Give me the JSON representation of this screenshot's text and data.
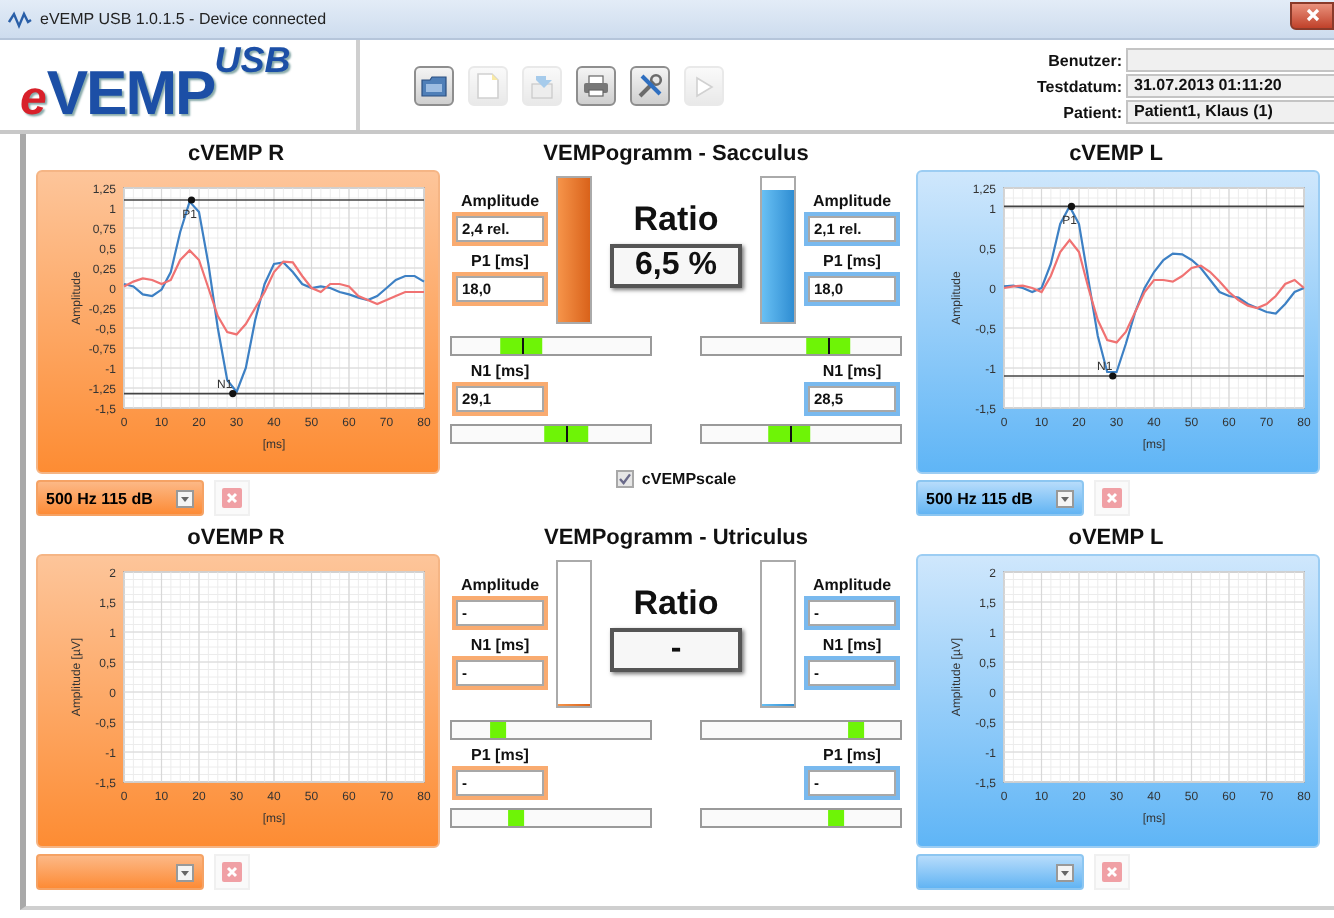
{
  "window": {
    "title": "eVEMP USB 1.0.1.5 - Device connected"
  },
  "logo": {
    "prefix": "e",
    "text": "VEMP",
    "superscript": "USB"
  },
  "toolbar": [
    {
      "kind": "folder",
      "disabled": false
    },
    {
      "kind": "new",
      "disabled": true
    },
    {
      "kind": "export",
      "disabled": true
    },
    {
      "kind": "print",
      "disabled": false
    },
    {
      "kind": "tools",
      "disabled": false
    },
    {
      "kind": "play",
      "disabled": true
    }
  ],
  "patient_info": [
    {
      "label": "Benutzer:"
    },
    {
      "label": "Testdatum:",
      "value": "31.07.2013 01:11:20"
    },
    {
      "label": "Patient:",
      "value": "Patient1, Klaus (1)"
    }
  ],
  "cvemp_r": {
    "title": "cVEMP R",
    "dropdown": {
      "value": "500 Hz 115 dB"
    },
    "delete_button": {
      "disabled": true
    },
    "chart_data": {
      "type": "line",
      "xlabel": "[ms]",
      "ylabel": "Amplitude",
      "xlim": [
        0,
        80
      ],
      "ylim": [
        -1.5,
        1.25
      ],
      "x": [
        0,
        2.5,
        5,
        7.5,
        10,
        12.5,
        15,
        17.5,
        20,
        22.5,
        25,
        27.5,
        30,
        32.5,
        35,
        37.5,
        40,
        42.5,
        45,
        47.5,
        50,
        52.5,
        55,
        57.5,
        60,
        62.5,
        65,
        67.5,
        70,
        72.5,
        75,
        77.5,
        80
      ],
      "xticks": [
        0,
        10,
        20,
        30,
        40,
        50,
        60,
        70,
        80
      ],
      "yticks": [
        {
          "value": 1.25,
          "label": "1,25"
        },
        {
          "value": 1,
          "label": "1"
        },
        {
          "value": 0.75,
          "label": "0,75"
        },
        {
          "value": 0.5,
          "label": "0,5"
        },
        {
          "value": 0.25,
          "label": "0,25"
        },
        {
          "value": 0,
          "label": "0"
        },
        {
          "value": -0.25,
          "label": "-0,25"
        },
        {
          "value": -0.5,
          "label": "-0,5"
        },
        {
          "value": -0.75,
          "label": "-0,75"
        },
        {
          "value": -1,
          "label": "-1"
        },
        {
          "value": -1.25,
          "label": "-1,25"
        },
        {
          "value": -1.5,
          "label": "-1,5"
        }
      ],
      "series": [
        {
          "color": "#3d80c4",
          "values": [
            0.05,
            0.02,
            -0.08,
            -0.1,
            -0.02,
            0.2,
            0.7,
            1.08,
            0.95,
            0.3,
            -0.5,
            -1.15,
            -1.3,
            -1.0,
            -0.4,
            0.05,
            0.3,
            0.32,
            0.2,
            0.05,
            0.0,
            0.02,
            0.0,
            -0.05,
            -0.08,
            -0.12,
            -0.15,
            -0.1,
            0.0,
            0.1,
            0.15,
            0.15,
            0.08
          ]
        },
        {
          "color": "#f07272",
          "values": [
            0.02,
            0.08,
            0.12,
            0.1,
            0.05,
            0.1,
            0.35,
            0.47,
            0.35,
            0.0,
            -0.35,
            -0.55,
            -0.58,
            -0.45,
            -0.25,
            -0.05,
            0.2,
            0.33,
            0.32,
            0.15,
            0.0,
            -0.05,
            0.05,
            0.05,
            0.02,
            -0.1,
            -0.15,
            -0.2,
            -0.15,
            -0.1,
            -0.05,
            -0.05,
            -0.05
          ]
        }
      ],
      "grid": true,
      "ref_lines": [
        {
          "axis": "y",
          "value": 1.1
        },
        {
          "axis": "y",
          "value": -1.32
        }
      ],
      "annotations": [
        {
          "text": "P1",
          "x": 18,
          "y": 1.1
        },
        {
          "text": "N1",
          "x": 29,
          "y": -1.32
        }
      ]
    }
  },
  "sacculus": {
    "title": "VEMPogramm - Sacculus",
    "ratio_label": "Ratio",
    "ratio": "6,5 %",
    "left_fields": [
      {
        "label": "Amplitude",
        "value": "2,4 rel."
      },
      {
        "label": "P1 [ms]",
        "value": "18,0"
      }
    ],
    "left_bar": {
      "level": 1.0
    },
    "right_bar": {
      "level": 0.92
    },
    "right_fields": [
      {
        "label": "Amplitude",
        "value": "2,1 rel."
      },
      {
        "label": "P1 [ms]",
        "value": "18,0"
      }
    ],
    "range_bars": [
      {
        "level": 0.35,
        "marker": true
      },
      {
        "level": 0.64,
        "marker": true
      }
    ],
    "lower_fields": [
      {
        "label": "N1 [ms]",
        "value": "29,1"
      },
      {
        "label": "N1 [ms]",
        "value": "28,5"
      }
    ],
    "lower_range_bars": [
      {
        "level": 0.58,
        "marker": true
      },
      {
        "level": 0.44,
        "marker": true
      }
    ]
  },
  "scale_checkbox": {
    "label": "cVEMPscale",
    "checked": true
  },
  "cvemp_l": {
    "title": "cVEMP L",
    "dropdown": {
      "value": "500 Hz 115 dB"
    },
    "delete_button": {
      "disabled": true
    },
    "chart_data": {
      "type": "line",
      "xlabel": "[ms]",
      "ylabel": "Amplitude",
      "xlim": [
        0,
        80
      ],
      "ylim": [
        -1.5,
        1.25
      ],
      "x": [
        0,
        2.5,
        5,
        7.5,
        10,
        12.5,
        15,
        17.5,
        20,
        22.5,
        25,
        27.5,
        30,
        32.5,
        35,
        37.5,
        40,
        42.5,
        45,
        47.5,
        50,
        52.5,
        55,
        57.5,
        60,
        62.5,
        65,
        67.5,
        70,
        72.5,
        75,
        77.5,
        80
      ],
      "xticks": [
        0,
        10,
        20,
        30,
        40,
        50,
        60,
        70,
        80
      ],
      "yticks": [
        {
          "value": 1.25,
          "label": "1,25"
        },
        {
          "value": 1,
          "label": "1"
        },
        {
          "value": 0.5,
          "label": "0,5"
        },
        {
          "value": 0,
          "label": "0"
        },
        {
          "value": -0.5,
          "label": "-0,5"
        },
        {
          "value": -1,
          "label": "-1"
        },
        {
          "value": -1.5,
          "label": "-1,5"
        }
      ],
      "series": [
        {
          "color": "#3d80c4",
          "values": [
            0.02,
            0.03,
            0.0,
            -0.05,
            0.0,
            0.3,
            0.8,
            1.02,
            0.8,
            0.1,
            -0.6,
            -1.05,
            -1.05,
            -0.7,
            -0.3,
            0.0,
            0.2,
            0.35,
            0.43,
            0.42,
            0.35,
            0.25,
            0.1,
            -0.05,
            -0.1,
            -0.12,
            -0.2,
            -0.25,
            -0.3,
            -0.32,
            -0.2,
            -0.05,
            0.0
          ]
        },
        {
          "color": "#f07272",
          "values": [
            0.0,
            0.02,
            0.03,
            0.0,
            -0.05,
            0.15,
            0.45,
            0.6,
            0.45,
            0.0,
            -0.4,
            -0.65,
            -0.68,
            -0.55,
            -0.3,
            -0.05,
            0.1,
            0.1,
            0.08,
            0.15,
            0.25,
            0.28,
            0.2,
            0.08,
            -0.05,
            -0.15,
            -0.22,
            -0.25,
            -0.2,
            -0.1,
            0.05,
            0.1,
            0.0
          ]
        }
      ],
      "grid": true,
      "ref_lines": [
        {
          "axis": "y",
          "value": 1.02
        },
        {
          "axis": "y",
          "value": -1.1
        }
      ],
      "annotations": [
        {
          "text": "P1",
          "x": 18,
          "y": 1.02
        },
        {
          "text": "N1",
          "x": 29,
          "y": -1.1
        }
      ]
    }
  },
  "ovemp_r": {
    "title": "oVEMP R",
    "delete_button": {
      "disabled": true
    },
    "chart_data": {
      "type": "line",
      "grid": true,
      "xlabel": "[ms]",
      "ylabel": "Amplitude [µV]",
      "xlim": [
        0,
        80
      ],
      "ylim": [
        -1.5,
        2
      ],
      "xticks": [
        0,
        10,
        20,
        30,
        40,
        50,
        60,
        70,
        80
      ],
      "yticks": [
        {
          "value": 2,
          "label": "2"
        },
        {
          "value": 1.5,
          "label": "1,5"
        },
        {
          "value": 1,
          "label": "1"
        },
        {
          "value": 0.5,
          "label": "0,5"
        },
        {
          "value": 0,
          "label": "0"
        },
        {
          "value": -0.5,
          "label": "-0,5"
        },
        {
          "value": -1,
          "label": "-1"
        },
        {
          "value": -1.5,
          "label": "-1,5"
        }
      ]
    }
  },
  "utriculus": {
    "title": "VEMPogramm - Utriculus",
    "ratio_label": "Ratio",
    "ratio": "-",
    "left_fields": [
      {
        "label": "Amplitude",
        "value": "-"
      },
      {
        "label": "N1 [ms]",
        "value": "-"
      }
    ],
    "left_bar": {
      "level": 0.02
    },
    "right_bar": {
      "level": 0
    },
    "right_fields": [
      {
        "label": "Amplitude",
        "value": "-"
      },
      {
        "label": "N1 [ms]",
        "value": "-"
      }
    ],
    "range_bars": [
      {
        "level": 0.23,
        "marker": false
      },
      {
        "level": 0.78,
        "marker": false
      }
    ],
    "lower_fields": [
      {
        "label": "P1 [ms]",
        "value": "-"
      },
      {
        "label": "P1 [ms]",
        "value": "-"
      }
    ],
    "lower_range_bars": [
      {
        "level": 0.32,
        "marker": false
      },
      {
        "level": 0.68,
        "marker": false
      }
    ]
  },
  "ovemp_l": {
    "title": "oVEMP L",
    "delete_button": {
      "disabled": true
    },
    "chart_data": {
      "type": "line",
      "grid": true,
      "xlabel": "[ms]",
      "ylabel": "Amplitude [µV]",
      "xlim": [
        0,
        80
      ],
      "ylim": [
        -1.5,
        2
      ],
      "xticks": [
        0,
        10,
        20,
        30,
        40,
        50,
        60,
        70,
        80
      ],
      "yticks": [
        {
          "value": 2,
          "label": "2"
        },
        {
          "value": 1.5,
          "label": "1,5"
        },
        {
          "value": 1,
          "label": "1"
        },
        {
          "value": 0.5,
          "label": "0,5"
        },
        {
          "value": 0,
          "label": "0"
        },
        {
          "value": -0.5,
          "label": "-0,5"
        },
        {
          "value": -1,
          "label": "-1"
        },
        {
          "value": -1.5,
          "label": "-1,5"
        }
      ]
    }
  }
}
